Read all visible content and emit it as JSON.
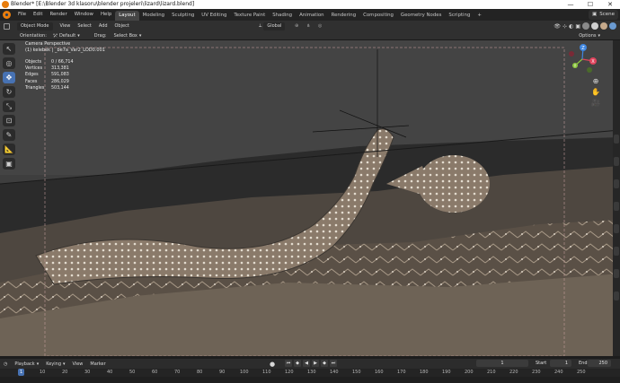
{
  "window": {
    "title": "Blender* [E:\\Blender 3d klasoru\\blender projeleri\\lizard\\lizard.blend]",
    "controls": [
      "—",
      "☐",
      "✕"
    ]
  },
  "menu": {
    "items": [
      "File",
      "Edit",
      "Render",
      "Window",
      "Help"
    ]
  },
  "workspaces": [
    "Layout",
    "Modeling",
    "Sculpting",
    "UV Editing",
    "Texture Paint",
    "Shading",
    "Animation",
    "Rendering",
    "Compositing",
    "Geometry Nodes",
    "Scripting",
    "+"
  ],
  "active_workspace": "Layout",
  "scene": {
    "label": "Scene"
  },
  "header": {
    "mode": "Object Mode",
    "view": "View",
    "select": "Select",
    "add": "Add",
    "object": "Object",
    "transform": "Global"
  },
  "tool_header": {
    "orientation_label": "Orientation:",
    "orientation_value": "Default",
    "drag_label": "Drag:",
    "drag_value": "Select Box",
    "options": "Options"
  },
  "viewport": {
    "perspective": "Camera Perspective",
    "object_name": "(1) kelebek | _be7a_Var2_LOD0.001"
  },
  "stats": [
    {
      "label": "Objects",
      "value": "0 / 66,714"
    },
    {
      "label": "Vertices",
      "value": "313,381"
    },
    {
      "label": "Edges",
      "value": "591,083"
    },
    {
      "label": "Faces",
      "value": "286,029"
    },
    {
      "label": "Triangles",
      "value": "503,144"
    }
  ],
  "gizmo": {
    "x": "X",
    "y": "Y",
    "z": "Z"
  },
  "timeline": {
    "playback": "Playback",
    "keying": "Keying",
    "view": "View",
    "marker": "Marker",
    "current_frame": "1",
    "start_label": "Start",
    "start": "1",
    "end_label": "End",
    "end": "250",
    "ruler": [
      "1",
      "10",
      "20",
      "30",
      "40",
      "50",
      "60",
      "70",
      "80",
      "90",
      "100",
      "110",
      "120",
      "130",
      "140",
      "150",
      "160",
      "170",
      "180",
      "190",
      "200",
      "210",
      "220",
      "230",
      "240",
      "250"
    ]
  },
  "colors": {
    "accent": "#4772b3",
    "orange": "#e87d0d",
    "x_axis": "#e0445d",
    "y_axis": "#8cc63f",
    "z_axis": "#3f86e0"
  }
}
